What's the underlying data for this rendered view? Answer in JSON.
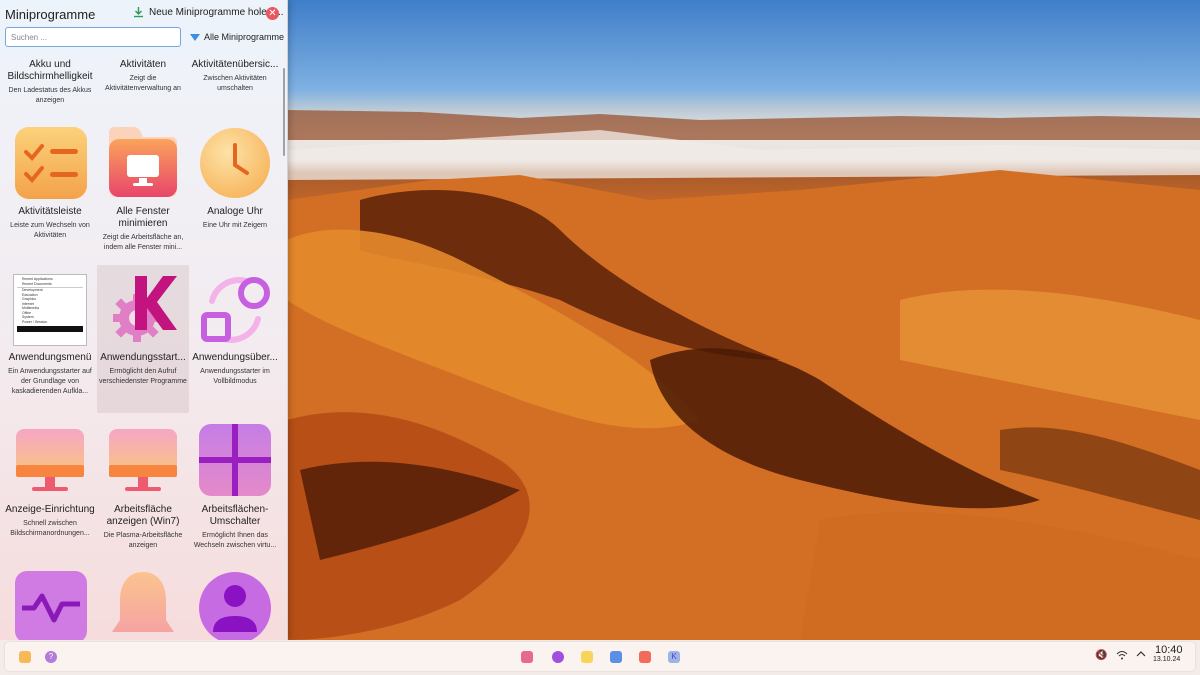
{
  "panel": {
    "title": "Miniprogramme",
    "get_new_label": "Neue Miniprogramme holen ...",
    "search_placeholder": "Suchen ...",
    "filter_label": "Alle Miniprogramme"
  },
  "widgets": [
    {
      "name": "Akku und Bildschirmhelligkeit",
      "desc": "Den Ladestatus des Akkus anzeigen"
    },
    {
      "name": "Aktivitäten",
      "desc": "Zeigt die Aktivitätenverwaltung an"
    },
    {
      "name": "Aktivitätenübersic...",
      "desc": "Zwischen Aktivitäten umschalten"
    },
    {
      "name": "Aktivitätsleiste",
      "desc": "Leiste zum Wechseln von Aktivitäten",
      "icon": "checklist-icon"
    },
    {
      "name": "Alle Fenster minimieren",
      "desc": "Zeigt die Arbeitsfläche an, indem alle Fenster mini...",
      "icon": "monitor-icon"
    },
    {
      "name": "Analoge Uhr",
      "desc": "Eine Uhr mit Zeigern",
      "icon": "clock-icon"
    },
    {
      "name": "Anwendungsmenü",
      "desc": "Ein Anwendungsstarter auf der Grundlage von kaskadierenden Aufkla...",
      "icon": "app-menu-preview-icon"
    },
    {
      "name": "Anwendungsstart...",
      "desc": "Ermöglicht den Aufruf verschiedenster Programme",
      "icon": "kde-launcher-icon"
    },
    {
      "name": "Anwendungsüber...",
      "desc": "Anwendungsstarter im Vollbildmodus",
      "icon": "dashboard-icon"
    },
    {
      "name": "Anzeige-Einrichtung",
      "desc": "Schnell zwischen Bildschirmanordnungen...",
      "icon": "display-icon"
    },
    {
      "name": "Arbeitsfläche anzeigen (Win7)",
      "desc": "Die Plasma-Arbeitsfläche anzeigen",
      "icon": "show-desktop-icon"
    },
    {
      "name": "Arbeitsflächen-Umschalter",
      "desc": "Ermöglicht Ihnen das Wechseln zwischen virtu...",
      "icon": "pager-icon"
    }
  ],
  "preview_menu": [
    "Recent Applications",
    "Recent Documents",
    "Development",
    "Education",
    "Graphics",
    "Internet",
    "Multimedia",
    "Office",
    "System",
    "Power / Session"
  ],
  "clock": {
    "time": "10:40",
    "date": "13.10.24"
  },
  "colors": {
    "accent": "#3d8fe3",
    "close": "#e9575d"
  }
}
